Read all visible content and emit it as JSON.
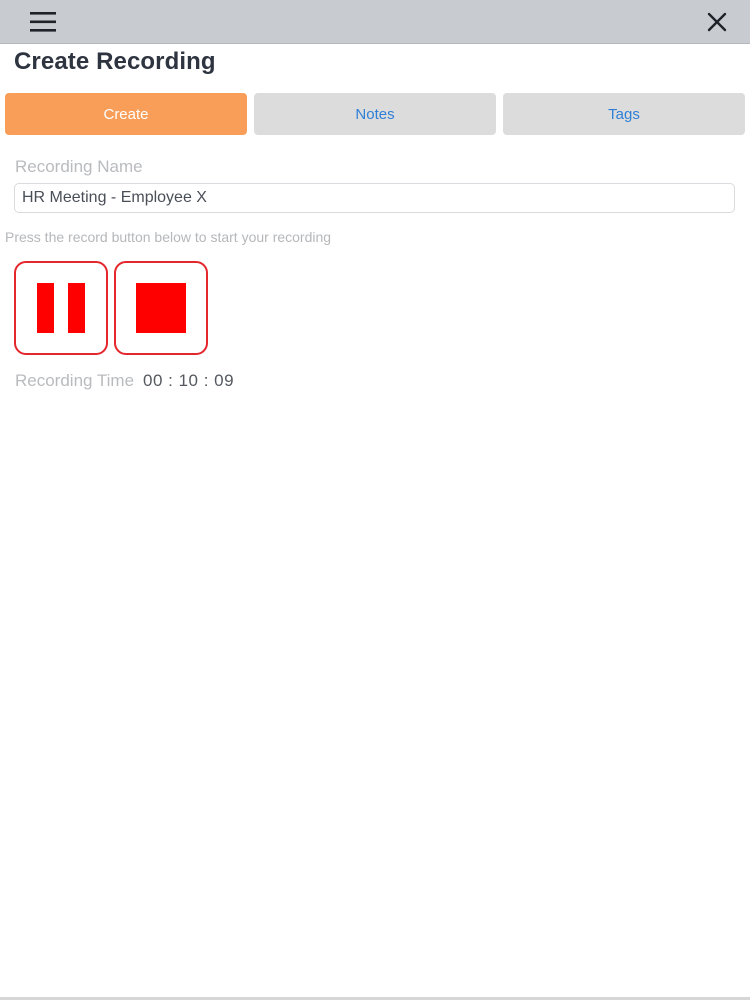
{
  "header": {
    "menu_icon": "hamburger-menu-icon",
    "close_icon": "close-x-icon",
    "bar_color": "#c8ccd1"
  },
  "page": {
    "title": "Create Recording"
  },
  "tabs": [
    {
      "label": "Create",
      "active": true,
      "color": "#f89e58"
    },
    {
      "label": "Notes",
      "active": false
    },
    {
      "label": "Tags",
      "active": false
    }
  ],
  "form": {
    "recording_name_label": "Recording Name",
    "recording_name_value": "HR Meeting - Employee X"
  },
  "recorder": {
    "hint": "Press the record button below to start your recording",
    "pause_icon": "pause-icon",
    "stop_icon": "stop-icon",
    "control_color": "#ff0000",
    "time_label": "Recording Time",
    "time_value": "00 : 10 : 09"
  }
}
